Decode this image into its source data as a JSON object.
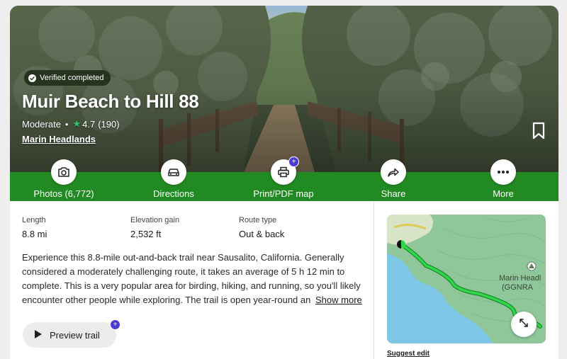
{
  "hero": {
    "badge": "Verified completed",
    "title": "Muir Beach to Hill 88",
    "difficulty": "Moderate",
    "separator": "•",
    "rating": "4.7",
    "reviews": "(190)",
    "park": "Marin Headlands"
  },
  "actions": [
    {
      "label": "Photos (6,772)",
      "icon": "camera-icon"
    },
    {
      "label": "Directions",
      "icon": "car-icon"
    },
    {
      "label": "Print/PDF map",
      "icon": "printer-icon",
      "badge": "+"
    },
    {
      "label": "Share",
      "icon": "share-arrow-icon"
    },
    {
      "label": "More",
      "icon": "more-dots-icon"
    }
  ],
  "stats": [
    {
      "label": "Length",
      "value": "8.8 mi"
    },
    {
      "label": "Elevation gain",
      "value": "2,532 ft"
    },
    {
      "label": "Route type",
      "value": "Out & back"
    }
  ],
  "description": "Experience this 8.8-mile out-and-back trail near Sausalito, California. Generally considered a moderately challenging route, it takes an average of 5 h 12 min to complete. This is a very popular area for birding, hiking, and running, so you'll likely encounter other people while exploring. The trail is open year-round and",
  "show_more": "Show more",
  "preview": {
    "label": "Preview trail",
    "badge": "+"
  },
  "map": {
    "label_line1": "Marin Headl",
    "label_line2": "(GGNRA"
  },
  "suggest_edit": "Suggest edit",
  "colors": {
    "action_bar": "#228a22",
    "route": "#2fd84a",
    "map_land": "#8fc79a",
    "map_water": "#7fc7e6",
    "badge_purple": "#4a3ad8"
  }
}
